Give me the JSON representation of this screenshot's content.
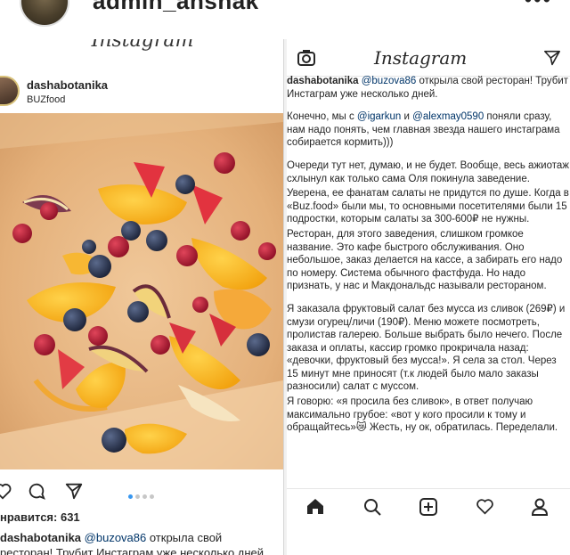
{
  "outer": {
    "username": "admin_ansnak",
    "more_icon": "more-dots-icon"
  },
  "left_post": {
    "logo": "Instagram",
    "username": "dashabotanika",
    "location": "BUZfood",
    "likes": "нравится: 631",
    "caption_user": "dashabotanika",
    "caption_mention": "@buzova86",
    "caption_line1_rest": "открыла свой",
    "caption_line2": "ресторан! Трубит Инстаграм уже несколько дней"
  },
  "right_post": {
    "logo": "Instagram",
    "username": "dashabotanika",
    "mention": "@buzova86",
    "intro_rest": "открыла свой ресторан! Трубит Инстаграм уже несколько дней.",
    "p1_a": "Конечно, мы с ",
    "mention2": "@igarkun",
    "p1_b": " и ",
    "mention3": "@alexmay0590",
    "p1_c": " поняли сразу, нам надо понять, чем главная звезда нашего инстаграма собирается кормить)))",
    "p2": "Очереди тут нет, думаю, и не будет. Вообще, весь ажиотаж схлынул как только сама Оля покинула заведение.",
    "p3": "Уверена, ее фанатам салаты не придутся по душе. Когда в «Buz.food» были мы, то основными посетителями были 15 подростки, которым салаты за 300-600₽ не нужны.",
    "p4": "Ресторан, для этого заведения, слишком громкое название. Это кафе быстрого обслуживания. Оно небольшое, заказ делается на кассе, а забирать его надо по номеру. Система обычного фастфуда. Но надо признать, у нас и Макдональдс называли рестораном.",
    "p5": "Я заказала фруктовый салат без мусса из сливок (269₽) и смузи огурец/личи (190₽). Меню можете посмотреть, пролистав галерею. Больше выбрать было нечего. После заказа и оплаты, кассир громко прокричала назад: «девочки, фруктовый без мусса!». Я села за стол. Через 15 минут мне приносят (т.к людей было мало заказы разносили) салат с муссом.",
    "p6": "Я говорю: «я просила без сливок», в ответ получаю максимально грубое: «вот у кого просили к тому и обращайтесь»😿 Жесть, ну ок, обратилась. Переделали."
  },
  "icons": {
    "left_actions": [
      "heart-icon",
      "comment-icon",
      "share-icon"
    ],
    "right_top": [
      "camera-icon",
      "send-icon"
    ],
    "right_nav": [
      "home-icon",
      "search-icon",
      "add-icon",
      "activity-icon",
      "profile-icon"
    ]
  },
  "colors": {
    "mention": "#003569",
    "carousel_active": "#3897f0",
    "carousel_inactive": "#c7c7c7"
  }
}
